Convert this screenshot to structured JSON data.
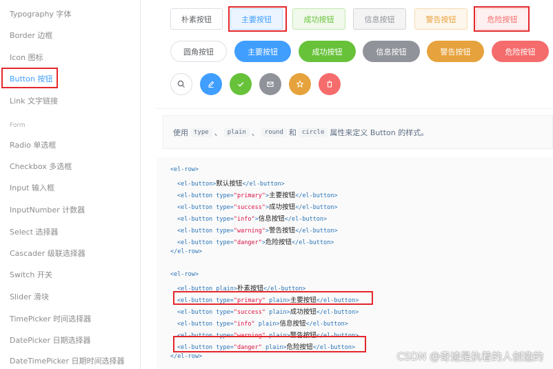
{
  "sidebar": {
    "items": [
      {
        "label": "Typography 字体"
      },
      {
        "label": "Border 边框"
      },
      {
        "label": "Icon 图标"
      },
      {
        "label": "Button 按钮"
      },
      {
        "label": "Link 文字链接"
      },
      {
        "label": "Form"
      },
      {
        "label": "Radio 单选框"
      },
      {
        "label": "Checkbox 多选框"
      },
      {
        "label": "Input 输入框"
      },
      {
        "label": "InputNumber 计数器"
      },
      {
        "label": "Select 选择器"
      },
      {
        "label": "Cascader 级联选择器"
      },
      {
        "label": "Switch 开关"
      },
      {
        "label": "Slider 滑块"
      },
      {
        "label": "TimePicker 时间选择器"
      },
      {
        "label": "DatePicker 日期选择器"
      },
      {
        "label": "DateTimePicker 日期时间选择器"
      }
    ]
  },
  "demo": {
    "plain_row": [
      "朴素按钮",
      "主要按钮",
      "成功按钮",
      "信息按钮",
      "警告按钮",
      "危险按钮"
    ],
    "round_row": [
      "圆角按钮",
      "主要按钮",
      "成功按钮",
      "信息按钮",
      "警告按钮",
      "危险按钮"
    ],
    "circle_row": [
      "search-icon",
      "edit-icon",
      "check-icon",
      "message-icon",
      "star-icon",
      "delete-icon"
    ]
  },
  "description": {
    "prefix": "使用",
    "tag1": "type",
    "sep1": "、",
    "tag2": "plain",
    "sep2": "、",
    "tag3": "round",
    "and": "和",
    "tag4": "circle",
    "suffix": "属性来定义 Button 的样式。"
  },
  "code": {
    "l1_open": "<el-row>",
    "l2_tag": "<el-button>",
    "l2_text": "默认按钮",
    "l2_close": "</el-button>",
    "l3_tag": "<el-button type=",
    "l3_str": "\"primary\"",
    "l3_gt": ">",
    "l3_text": "主要按钮",
    "l3_close": "</el-button>",
    "l4_tag": "<el-button type=",
    "l4_str": "\"success\"",
    "l4_gt": ">",
    "l4_text": "成功按钮",
    "l4_close": "</el-button>",
    "l5_tag": "<el-button type=",
    "l5_str": "\"info\"",
    "l5_gt": ">",
    "l5_text": "信息按钮",
    "l5_close": "</el-button>",
    "l6_tag": "<el-button type=",
    "l6_str": "\"warning\"",
    "l6_gt": ">",
    "l6_text": "警告按钮",
    "l6_close": "</el-button>",
    "l7_tag": "<el-button type=",
    "l7_str": "\"danger\"",
    "l7_gt": ">",
    "l7_text": "危险按钮",
    "l7_close": "</el-button>",
    "l8_close": "</el-row>",
    "l9_open": "<el-row>",
    "l10_tag": "<el-button plain>",
    "l10_text": "朴素按钮",
    "l10_close": "</el-button>",
    "l11_tag": "<el-button type=",
    "l11_str": "\"primary\"",
    "l11_gt": " plain>",
    "l11_text": "主要按钮",
    "l11_close": "</el-button>",
    "l12_tag": "<el-button type=",
    "l12_str": "\"success\"",
    "l12_gt": " plain>",
    "l12_text": "成功按钮",
    "l12_close": "</el-button>",
    "l13_tag": "<el-button type=",
    "l13_str": "\"info\"",
    "l13_gt": " plain>",
    "l13_text": "信息按钮",
    "l13_close": "</el-button>",
    "l14_tag": "<el-button type=",
    "l14_str": "\"warning\"",
    "l14_gt": " plain>",
    "l14_text": "警告按钮",
    "l14_close": "</el-button>",
    "l15_tag": "<el-button type=",
    "l15_str": "\"danger\"",
    "l15_gt": " plain>",
    "l15_text": "危险按钮",
    "l15_close": "</el-button>",
    "l16_close": "</el-row>"
  },
  "watermark": "CSDN @奇迹是执着的人创造的",
  "colors": {
    "primary": "#409eff",
    "success": "#67c23a",
    "info": "#909399",
    "warning": "#e6a23c",
    "danger": "#f56c6c",
    "highlight": "#e3262b"
  }
}
